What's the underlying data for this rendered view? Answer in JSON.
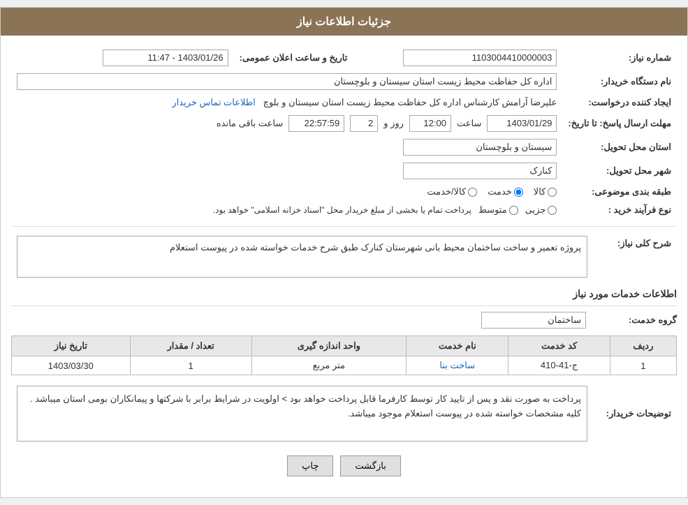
{
  "header": {
    "title": "جزئیات اطلاعات نیاز"
  },
  "fields": {
    "need_number_label": "شماره نیاز:",
    "need_number_value": "1103004410000003",
    "date_time_label": "تاریخ و ساعت اعلان عمومی:",
    "date_time_value": "1403/01/26 - 11:47",
    "buyer_org_label": "نام دستگاه خریدار:",
    "buyer_org_value": "اداره کل حفاظت محیط زیست استان سیستان و بلوچستان",
    "creator_label": "ایجاد کننده درخواست:",
    "creator_value": "علیرضا آرامش کارشناس اداره کل حفاظت محیط زیست استان سیستان و بلوچ",
    "creator_link": "اطلاعات تماس خریدار",
    "deadline_label": "مهلت ارسال پاسخ: تا تاریخ:",
    "deadline_date": "1403/01/29",
    "deadline_time_label": "ساعت",
    "deadline_time": "12:00",
    "deadline_days_label": "روز و",
    "deadline_days": "2",
    "deadline_remaining_label": "ساعت باقی مانده",
    "deadline_remaining": "22:57:59",
    "province_label": "استان محل تحویل:",
    "province_value": "سیستان و بلوچستان",
    "city_label": "شهر محل تحویل:",
    "city_value": "کنارک",
    "category_label": "طبقه بندی موضوعی:",
    "category_options": [
      "کالا",
      "خدمت",
      "کالا/خدمت"
    ],
    "category_selected": "خدمت",
    "purchase_type_label": "نوع فرآیند خرید :",
    "purchase_type_options": [
      "جزیی",
      "متوسط"
    ],
    "purchase_type_note": "پرداخت تمام یا بخشی از مبلغ خریدار محل \"اسناد خزانه اسلامی\" خواهد بود.",
    "description_label": "شرح کلی نیاز:",
    "description_value": "پروژه تعمیر و ساخت ساختمان محیط بانی شهرستان کنارک طبق شرح خدمات خواسته شده در پیوست استعلام",
    "services_section_label": "اطلاعات خدمات مورد نیاز",
    "service_group_label": "گروه خدمت:",
    "service_group_value": "ساختمان",
    "table": {
      "headers": [
        "ردیف",
        "کد خدمت",
        "نام خدمت",
        "واحد اندازه گیری",
        "تعداد / مقدار",
        "تاریخ نیاز"
      ],
      "rows": [
        {
          "row_num": "1",
          "service_code": "ج-41-410",
          "service_name": "ساخت بنا",
          "unit": "متر مربع",
          "quantity": "1",
          "date": "1403/03/30"
        }
      ]
    },
    "notes_label": "توضیحات خریدار:",
    "notes_value": "پرداخت به صورت نقد و پس از تایید کار توسط کارفرما قابل پرداخت خواهد بود > اولویت در شرایط برابر با شرکتها و پیمانکاران بومی استان میباشد . کلیه مشخصات خواسته شده در پیوست استعلام موجود میباشد."
  },
  "buttons": {
    "back_label": "بازگشت",
    "print_label": "چاپ"
  }
}
